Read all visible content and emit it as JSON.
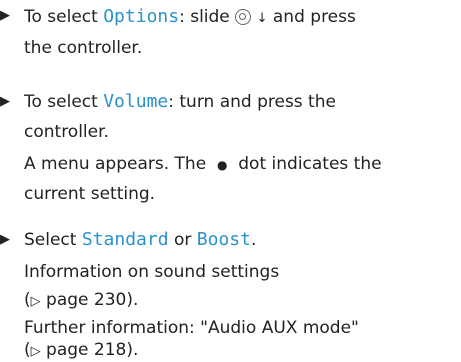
{
  "colors": {
    "text": "#222222",
    "highlight": "#2a92c9"
  },
  "bullet_symbol": "▶",
  "step1": {
    "prefix": "To select ",
    "term": "Options",
    "middle": ": slide ",
    "controller_icon": "controller-icon",
    "arrow": "↓",
    "suffix": " and press",
    "line2": "the controller."
  },
  "step2": {
    "prefix": "To select ",
    "term": "Volume",
    "suffix": ": turn and press the",
    "line2": "controller.",
    "line3_a": "A menu appears. The ",
    "dot": "●",
    "line3_b": " dot indicates the",
    "line4": "current setting."
  },
  "step3": {
    "prefix": "Select ",
    "term1": "Standard",
    "or": " or ",
    "term2": "Boost",
    "period": ".",
    "info1": "Information on sound settings",
    "ref1_symbol": "▷",
    "ref1_text": " page 230).",
    "ref1_open": "(",
    "info2": "Further information: \"Audio AUX mode\"",
    "ref2_open": "(",
    "ref2_symbol": "▷",
    "ref2_text": " page 218)."
  }
}
